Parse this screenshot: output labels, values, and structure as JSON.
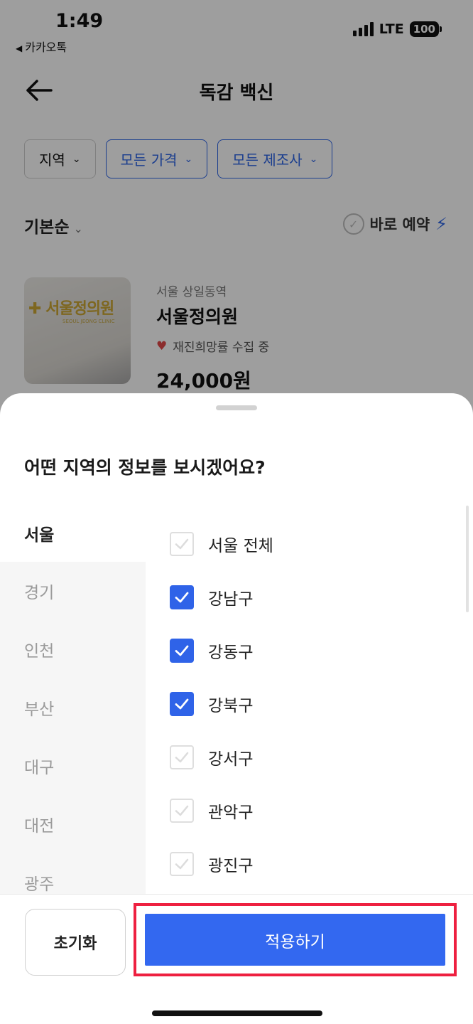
{
  "status_bar": {
    "time": "1:49",
    "back_app": "카카오톡",
    "network": "LTE",
    "battery": "100"
  },
  "nav": {
    "title": "독감 백신"
  },
  "filters": [
    {
      "label": "지역",
      "active": false
    },
    {
      "label": "모든 가격",
      "active": true
    },
    {
      "label": "모든 제조사",
      "active": true
    }
  ],
  "sort": {
    "label": "기본순",
    "instant_booking": "바로 예약"
  },
  "listing": {
    "location": "서울 상일동역",
    "name": "서울정의원",
    "revisit": "재진희망률 수집 중",
    "price": "24,000원",
    "thumb_logo": "서울정의원",
    "thumb_logo_sub": "SEOUL JEONG CLINIC"
  },
  "sheet": {
    "title": "어떤 지역의 정보를 보시겠어요?",
    "regions": [
      {
        "label": "서울",
        "active": true
      },
      {
        "label": "경기",
        "active": false
      },
      {
        "label": "인천",
        "active": false
      },
      {
        "label": "부산",
        "active": false
      },
      {
        "label": "대구",
        "active": false
      },
      {
        "label": "대전",
        "active": false
      },
      {
        "label": "광주",
        "active": false
      }
    ],
    "districts": [
      {
        "label": "서울 전체",
        "checked": false
      },
      {
        "label": "강남구",
        "checked": true
      },
      {
        "label": "강동구",
        "checked": true
      },
      {
        "label": "강북구",
        "checked": true
      },
      {
        "label": "강서구",
        "checked": false
      },
      {
        "label": "관악구",
        "checked": false
      },
      {
        "label": "광진구",
        "checked": false
      }
    ],
    "reset_label": "초기화",
    "apply_label": "적용하기"
  },
  "colors": {
    "accent": "#2f63e8",
    "highlight_border": "#ee2040",
    "dim_overlay": "rgba(0,0,0,0.38)"
  }
}
